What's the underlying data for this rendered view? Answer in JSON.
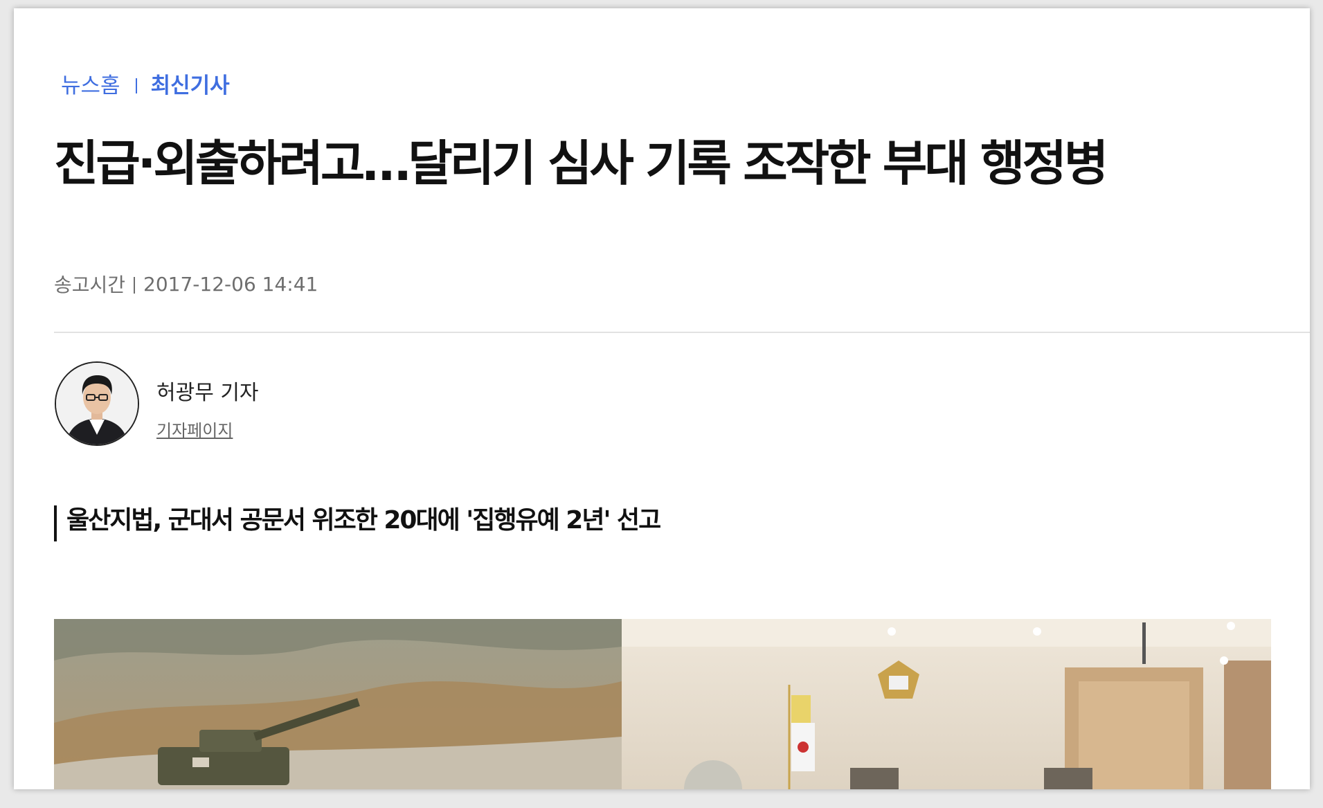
{
  "breadcrumb": {
    "home": "뉴스홈",
    "current": "최신기사"
  },
  "article": {
    "headline": "진급·외출하려고…달리기 심사 기록 조작한 부대 행정병",
    "sent_label": "송고시간",
    "sent_time": "2017-12-06 14:41",
    "subtitle": "울산지법, 군대서 공문서 위조한 20대에 '집행유예 2년' 선고"
  },
  "reporter": {
    "name": "허광무 기자",
    "page_link": "기자페이지"
  },
  "colors": {
    "accent": "#3f6ee0",
    "headline": "#111111",
    "meta": "#6e6e6e"
  }
}
